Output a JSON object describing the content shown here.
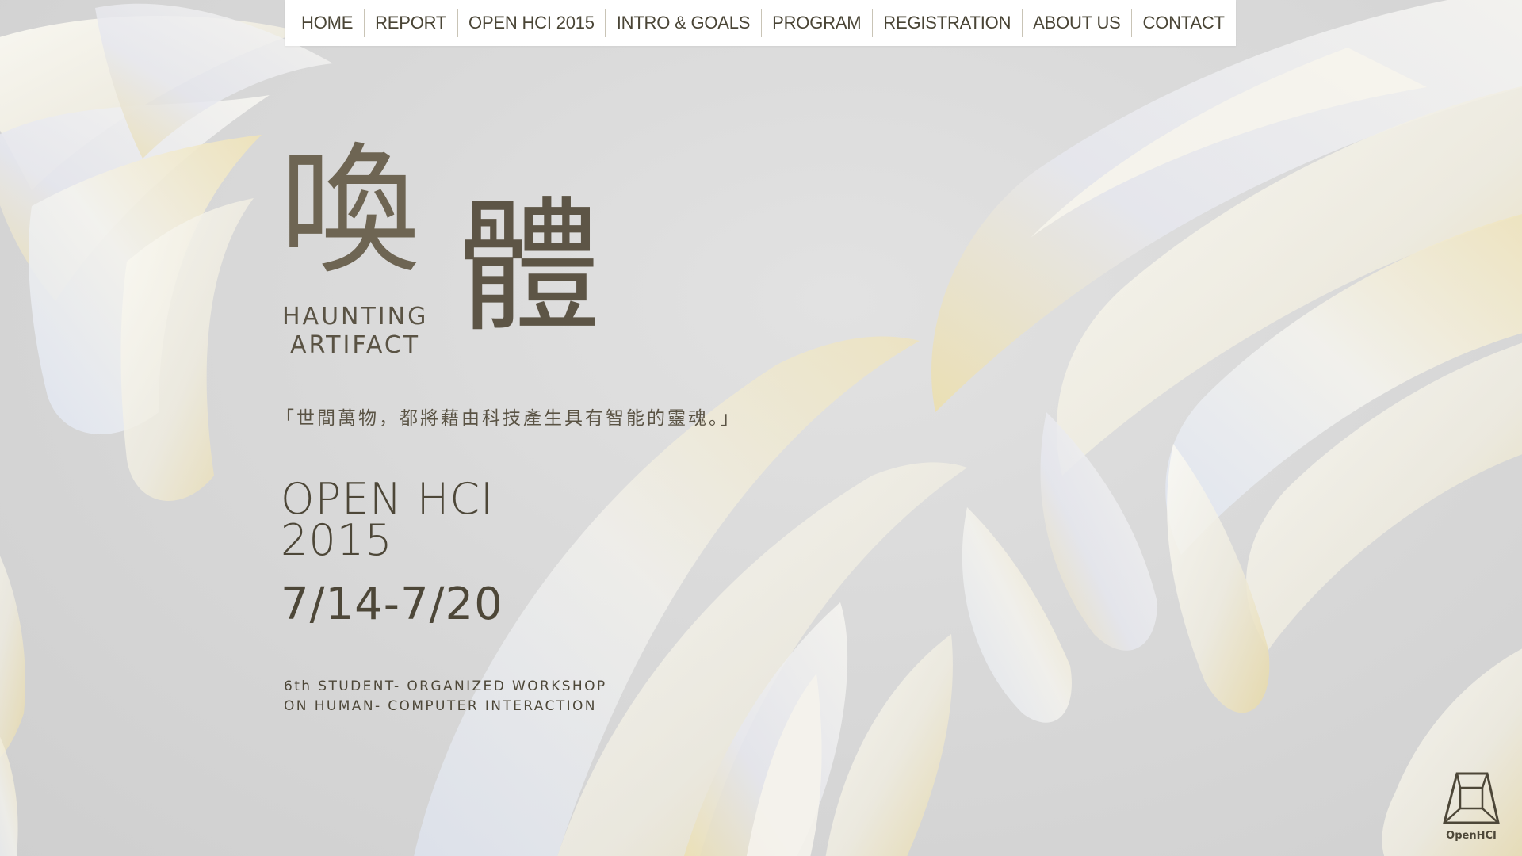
{
  "nav": {
    "items": [
      {
        "label": "HOME"
      },
      {
        "label": "REPORT"
      },
      {
        "label": "OPEN HCI 2015"
      },
      {
        "label": "INTRO & GOALS"
      },
      {
        "label": "PROGRAM"
      },
      {
        "label": "REGISTRATION"
      },
      {
        "label": "ABOUT US"
      },
      {
        "label": "CONTACT"
      }
    ]
  },
  "hero": {
    "logo_char_1": "喚",
    "logo_char_2": "體",
    "logo_en_1": "HAUNTING",
    "logo_en_2": "ARTIFACT",
    "quote": "「世間萬物，都將藉由科技產生具有智能的靈魂。」",
    "title_line_1": "OPEN HCI",
    "title_line_2": "2015",
    "dates": "7/14-7/20",
    "tagline_1": "6th STUDENT- ORGANIZED WORKSHOP",
    "tagline_2": "ON HUMAN- COMPUTER INTERACTION"
  },
  "corner_logo": {
    "label": "OpenHCI",
    "icon": "cube-frame-icon"
  },
  "colors": {
    "nav_background": "#ffffff",
    "text": "#4d4738",
    "page_background": "#d8d8d8",
    "petal": "#f1efe6",
    "petal_gold": "#e9dba8",
    "petal_blue": "#dbe3f3"
  }
}
